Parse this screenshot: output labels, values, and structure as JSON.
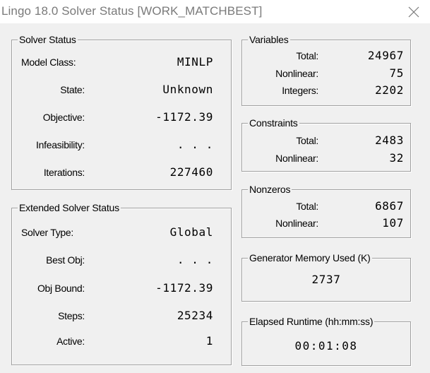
{
  "window": {
    "title": "Lingo 18.0 Solver Status [WORK_MATCHBEST]"
  },
  "solver_status": {
    "title": "Solver Status",
    "rows": [
      {
        "label": "Model Class:",
        "value": "MINLP"
      },
      {
        "label": "State:",
        "value": "Unknown"
      },
      {
        "label": "Objective:",
        "value": "-1172.39"
      },
      {
        "label": "Infeasibility:",
        "value": ". . ."
      },
      {
        "label": "Iterations:",
        "value": "227460"
      }
    ]
  },
  "extended_status": {
    "title": "Extended Solver Status",
    "rows": [
      {
        "label": "Solver Type:",
        "value": "Global"
      },
      {
        "label": "Best Obj:",
        "value": ". . ."
      },
      {
        "label": "Obj Bound:",
        "value": "-1172.39"
      },
      {
        "label": "Steps:",
        "value": "25234"
      },
      {
        "label": "Active:",
        "value": "1"
      }
    ]
  },
  "variables": {
    "title": "Variables",
    "rows": [
      {
        "label": "Total:",
        "value": "24967"
      },
      {
        "label": "Nonlinear:",
        "value": "75"
      },
      {
        "label": "Integers:",
        "value": "2202"
      }
    ]
  },
  "constraints": {
    "title": "Constraints",
    "rows": [
      {
        "label": "Total:",
        "value": "2483"
      },
      {
        "label": "Nonlinear:",
        "value": "32"
      }
    ]
  },
  "nonzeros": {
    "title": "Nonzeros",
    "rows": [
      {
        "label": "Total:",
        "value": "6867"
      },
      {
        "label": "Nonlinear:",
        "value": "107"
      }
    ]
  },
  "generator_memory": {
    "title": "Generator Memory Used (K)",
    "value": "2737"
  },
  "elapsed_runtime": {
    "title": "Elapsed Runtime (hh:mm:ss)",
    "value": "00:01:08"
  },
  "icons": {
    "close": "close-icon"
  }
}
